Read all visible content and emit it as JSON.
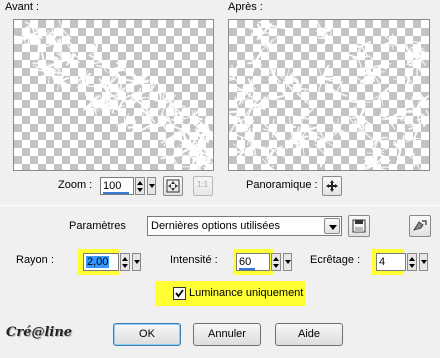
{
  "labels": {
    "before": "Avant :",
    "after": "Après :",
    "zoom": "Zoom :",
    "panoramic": "Panoramique :",
    "parameters": "Paramètres",
    "radius": "Rayon :",
    "intensity": "Intensité :",
    "clipping": "Ecrêtage :",
    "luminance": "Luminance uniquement"
  },
  "inputs": {
    "zoom_value": "100",
    "zoom_fixed": "1:1",
    "preset_value": "Dernières options utilisées",
    "radius_value": "2,00",
    "intensity_value": "60",
    "clipping_value": "4"
  },
  "checkbox": {
    "luminance_checked": true
  },
  "buttons": {
    "ok": "OK",
    "cancel": "Annuler",
    "help": "Aide"
  },
  "watermark": "Cré@line",
  "colors": {
    "highlight": "#ffff33",
    "slider_blue": "#3a78d6",
    "focus_blue": "#3399ff"
  },
  "icons": [
    "navigate-icon",
    "one-to-one-icon",
    "pan-icon",
    "save-preset-icon",
    "reset-icon",
    "dropdown-arrow-icon",
    "checkmark-icon"
  ]
}
